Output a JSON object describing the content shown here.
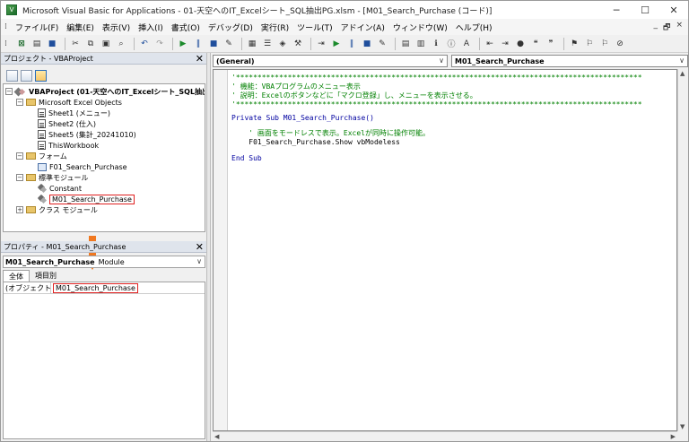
{
  "window": {
    "title": "Microsoft Visual Basic for Applications - 01-天空へのIT_Excelシート_SQL抽出PG.xlsm - [M01_Search_Purchase (コード)]",
    "controls": {
      "minimize": "─",
      "maximize": "☐",
      "close": "✕"
    },
    "mdi_controls": {
      "minimize": "_",
      "restore": "🗗",
      "close": "×"
    }
  },
  "menu": {
    "items": [
      "ファイル(F)",
      "編集(E)",
      "表示(V)",
      "挿入(I)",
      "書式(O)",
      "デバッグ(D)",
      "実行(R)",
      "ツール(T)",
      "アドイン(A)",
      "ウィンドウ(W)",
      "ヘルプ(H)"
    ]
  },
  "toolbar": {
    "icons": [
      "excel-icon",
      "insert-icon",
      "save-icon",
      "cut-icon",
      "copy-icon",
      "paste-icon",
      "find-icon",
      "undo-icon",
      "redo-icon",
      "run-icon",
      "break-icon",
      "reset-icon",
      "design-icon",
      "project-explorer-icon",
      "properties-icon",
      "object-browser-icon",
      "toolbox-icon"
    ],
    "accent": "#1b6a2b"
  },
  "project_explorer": {
    "title": "プロジェクト - VBAProject",
    "close": "✕",
    "root": "VBAProject (01-天空へのIT_Excelシート_SQL抽出",
    "groups": {
      "excel_objects": "Microsoft Excel Objects",
      "forms": "フォーム",
      "modules": "標準モジュール",
      "classes": "クラス モジュール"
    },
    "sheets": [
      "Sheet1 (メニュー)",
      "Sheet2 (仕入)",
      "Sheet5 (集計_20241010)",
      "ThisWorkbook"
    ],
    "forms": [
      "F01_Search_Purchase"
    ],
    "modules": [
      "Constant",
      "M01_Search_Purchase"
    ],
    "selected_module": "M01_Search_Purchase"
  },
  "properties": {
    "title": "プロパティ - M01_Search_Purchase",
    "close": "✕",
    "combo_name": "M01_Search_Purchase",
    "combo_type": "Module",
    "tabs": [
      "全体",
      "項目別"
    ],
    "rows": [
      {
        "key": "(オブジェクト名)",
        "value": "M01_Search_Purchase"
      }
    ]
  },
  "code_window": {
    "object_combo": "(General)",
    "proc_combo": "M01_Search_Purchase",
    "lines": [
      {
        "kind": "cm",
        "text": "'**********************************************************************************************"
      },
      {
        "kind": "cm",
        "text": "' 機能：VBAプログラムのメニュー表示"
      },
      {
        "kind": "cm",
        "text": "' 説明：Excelのボタンなどに「マクロ登録」し、メニューを表示させる。"
      },
      {
        "kind": "cm",
        "text": "'**********************************************************************************************"
      },
      {
        "kind": "blank",
        "text": ""
      },
      {
        "kind": "kw",
        "text": "Private Sub M01_Search_Purchase()"
      },
      {
        "kind": "blank",
        "text": ""
      },
      {
        "kind": "cm",
        "text": "    ' 画面をモードレスで表示。Excelが同時に操作可能。"
      },
      {
        "kind": "normal",
        "text": "    F01_Search_Purchase.Show vbModeless"
      },
      {
        "kind": "blank",
        "text": ""
      },
      {
        "kind": "kw",
        "text": "End Sub"
      }
    ]
  },
  "highlight_color": "#e02020",
  "arrow_color": "#f07820"
}
